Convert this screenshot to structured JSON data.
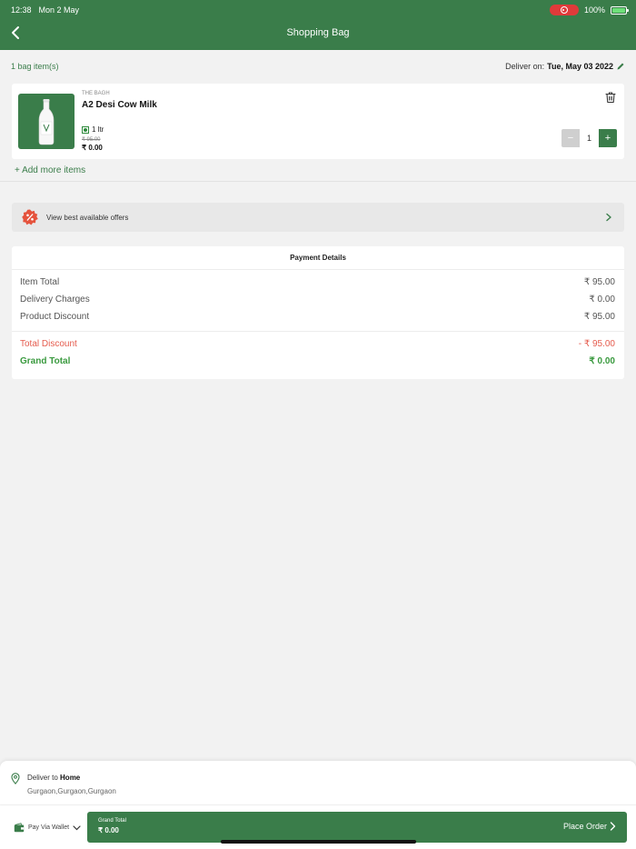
{
  "status_bar": {
    "time": "12:38",
    "date": "Mon 2 May",
    "battery": "100%"
  },
  "header": {
    "title": "Shopping Bag"
  },
  "summary": {
    "count": "1 bag item(s)",
    "deliver_label": "Deliver on:",
    "deliver_date": "Tue, May 03 2022"
  },
  "cart": {
    "items": [
      {
        "brand": "THE BAGH",
        "name": "A2 Desi Cow Milk",
        "variant": "1 ltr",
        "mrp": "₹ 95.00",
        "price": "₹  0.00",
        "quantity": "1"
      }
    ],
    "add_more": "+ Add more items"
  },
  "offers": {
    "label": "View best available offers"
  },
  "payment": {
    "heading": "Payment Details",
    "item_total_label": "Item Total",
    "item_total": "₹ 95.00",
    "delivery_label": "Delivery Charges",
    "delivery": "₹ 0.00",
    "product_discount_label": "Product Discount",
    "product_discount": "₹ 95.00",
    "total_discount_label": "Total Discount",
    "total_discount": "- ₹ 95.00",
    "grand_total_label": "Grand Total",
    "grand_total": "₹ 0.00"
  },
  "address": {
    "prefix": "Deliver to",
    "name": "Home",
    "line": "Gurgaon,Gurgaon,Gurgaon"
  },
  "footer": {
    "wallet_label": "Pay Via Wallet",
    "grand_total_label": "Grand Total",
    "grand_total": "₹ 0.00",
    "place_order": "Place Order"
  },
  "colors": {
    "primary": "#3a7d4a",
    "discount": "#e55b4d",
    "grand_total": "#3a9a3f",
    "background": "#f2f2f2"
  }
}
